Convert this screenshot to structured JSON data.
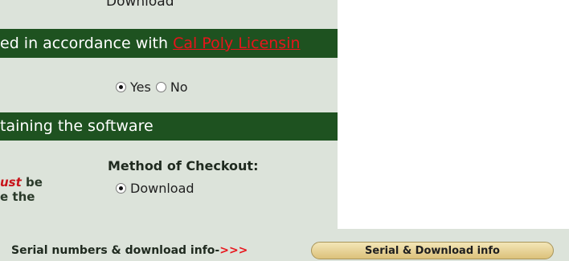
{
  "top_cut_text": "Download",
  "band1": {
    "text": "ed in accordance with ",
    "link": "Cal Poly Licensin"
  },
  "ownership": {
    "yes": "Yes",
    "no": "No",
    "selected": "Yes"
  },
  "band2": {
    "text": "taining the software"
  },
  "left_note": {
    "red": "ust",
    "line1_rest": " be",
    "line2": "e the"
  },
  "method": {
    "heading": "Method of Checkout:",
    "option": "Download"
  },
  "serial": {
    "label": "Serial numbers & download info-",
    "arrows": ">>>",
    "button": "Serial & Download info"
  }
}
